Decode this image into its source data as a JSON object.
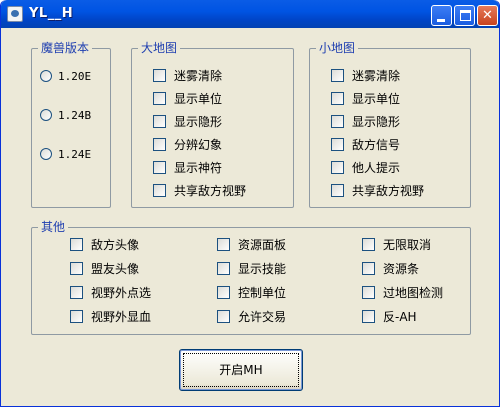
{
  "window": {
    "title": "YL__H",
    "accent": "#0054e3",
    "close_color": "#c8431f"
  },
  "title_buttons": {
    "minimize_icon": "minimize-icon",
    "maximize_icon": "maximize-icon",
    "close_glyph": "✕"
  },
  "version_group": {
    "legend": "魔兽版本",
    "options": [
      "1.20E",
      "1.24B",
      "1.24E"
    ]
  },
  "big_map_group": {
    "legend": "大地图",
    "options": [
      "迷雾清除",
      "显示单位",
      "显示隐形",
      "分辨幻象",
      "显示神符",
      "共享敌方视野"
    ]
  },
  "mini_map_group": {
    "legend": "小地图",
    "options": [
      "迷雾清除",
      "显示单位",
      "显示隐形",
      "敌方信号",
      "他人提示",
      "共享敌方视野"
    ]
  },
  "other_group": {
    "legend": "其他",
    "col1": [
      "敌方头像",
      "盟友头像",
      "视野外点选",
      "视野外显血"
    ],
    "col2": [
      "资源面板",
      "显示技能",
      "控制单位",
      "允许交易"
    ],
    "col3": [
      "无限取消",
      "资源条",
      "过地图检测",
      "反-AH"
    ]
  },
  "start_button": {
    "label": "开启MH"
  }
}
